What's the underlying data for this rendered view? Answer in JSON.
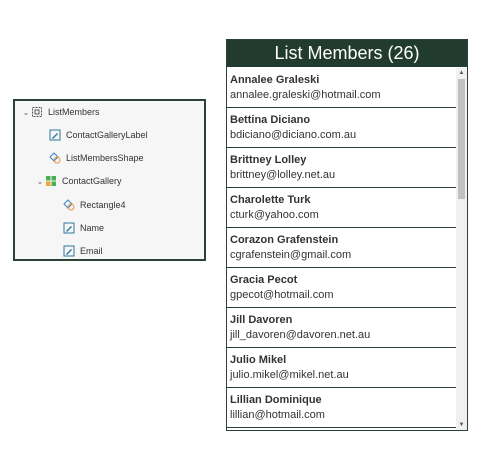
{
  "tree": {
    "root": {
      "label": "ListMembers",
      "icon": "screen-icon"
    },
    "items": [
      {
        "label": "ContactGalleryLabel",
        "icon": "label-edit-icon"
      },
      {
        "label": "ListMembersShape",
        "icon": "shape-icon"
      },
      {
        "label": "ContactGallery",
        "icon": "gallery-icon"
      }
    ],
    "gallery_children": [
      {
        "label": "Rectangle4",
        "icon": "shape-icon"
      },
      {
        "label": "Name",
        "icon": "label-edit-icon"
      },
      {
        "label": "Email",
        "icon": "label-edit-icon"
      }
    ]
  },
  "list": {
    "title": "List Members (26)",
    "members": [
      {
        "name": "Annalee Graleski",
        "email": "annalee.graleski@hotmail.com"
      },
      {
        "name": "Bettina Diciano",
        "email": "bdiciano@diciano.com.au"
      },
      {
        "name": "Brittney Lolley",
        "email": "brittney@lolley.net.au"
      },
      {
        "name": "Charolette Turk",
        "email": "cturk@yahoo.com"
      },
      {
        "name": "Corazon Grafenstein",
        "email": "cgrafenstein@gmail.com"
      },
      {
        "name": "Gracia Pecot",
        "email": "gpecot@hotmail.com"
      },
      {
        "name": "Jill Davoren",
        "email": "jill_davoren@davoren.net.au"
      },
      {
        "name": "Julio Mikel",
        "email": "julio.mikel@mikel.net.au"
      },
      {
        "name": "Lillian Dominique",
        "email": "lillian@hotmail.com"
      }
    ]
  },
  "colors": {
    "header_bg": "#223b2f",
    "border": "#2c4236",
    "label_icon": "#2b7a9a",
    "shape_icon_blue": "#3b7fc4",
    "shape_icon_orange": "#e8963a",
    "gallery_green": "#4caf50",
    "gallery_orange": "#f4a33a"
  }
}
